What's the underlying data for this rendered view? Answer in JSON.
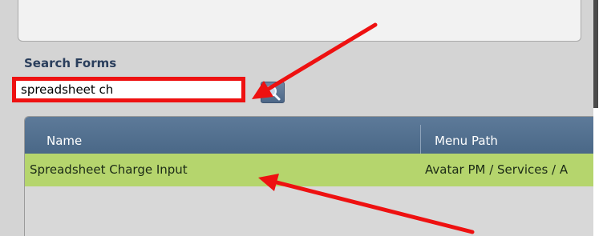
{
  "search_forms": {
    "title": "Search Forms",
    "query": "spreadsheet ch"
  },
  "results": {
    "columns": [
      "Name",
      "Menu Path"
    ],
    "rows": [
      {
        "name": "Spreadsheet Charge Input",
        "menu_path": "Avatar PM / Services / A"
      }
    ]
  },
  "colors": {
    "highlight": "#ee1111",
    "selected_row": "#b5d56d",
    "header": "#4a6887"
  }
}
